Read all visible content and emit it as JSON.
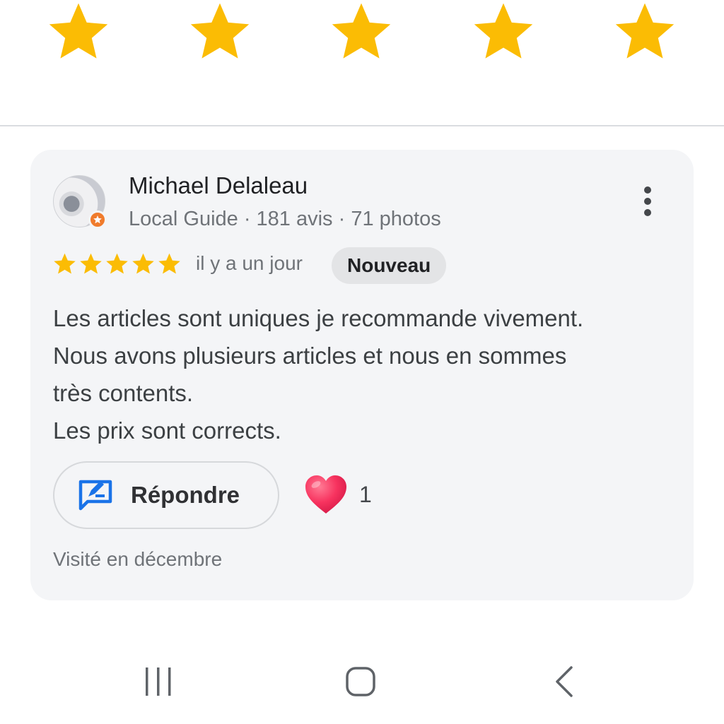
{
  "colors": {
    "star": "#fbbc04",
    "card_background": "#f4f5f7",
    "badge_background": "#e3e4e6",
    "reply_icon": "#1a73e8",
    "local_guide_badge": "#f07b2c",
    "heart": "#f0305a"
  },
  "top_rating": {
    "stars": 5,
    "icon": "star-icon"
  },
  "review": {
    "author": {
      "name": "Michael Delaleau",
      "meta": "Local Guide · 181 avis · 71 photos",
      "avatar_icon": "user-avatar",
      "badge_icon": "local-guide-badge-icon"
    },
    "more_icon": "more-vert-icon",
    "rating": 5,
    "date": "il y a un jour",
    "badge": "Nouveau",
    "text_lines": [
      "Les articles sont uniques je recommande vivement.",
      "Nous avons plusieurs articles et nous en sommes",
      "très contents.",
      "Les prix sont corrects."
    ],
    "reply": {
      "label": "Répondre",
      "icon": "reply-icon"
    },
    "likes": {
      "icon": "heart-icon",
      "count": "1"
    },
    "visited": "Visité en décembre"
  },
  "navbar": {
    "recent_icon": "recent-apps-icon",
    "home_icon": "home-icon",
    "back_icon": "back-icon"
  }
}
